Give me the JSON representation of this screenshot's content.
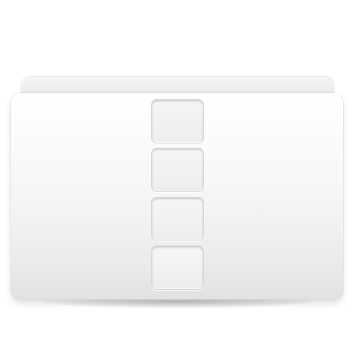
{
  "icon": {
    "name": "folder-icon",
    "style": "white glossy folder with vertical column of four rounded square slots",
    "colors": {
      "body_top": "#ffffff",
      "body_bottom": "#e2e2e2",
      "tab": "#eeeeee",
      "slot": "#f2f2f2",
      "slot_border": "#d6d6d6"
    },
    "slots": [
      {
        "id": "slot-1"
      },
      {
        "id": "slot-2"
      },
      {
        "id": "slot-3"
      },
      {
        "id": "slot-4"
      }
    ]
  }
}
